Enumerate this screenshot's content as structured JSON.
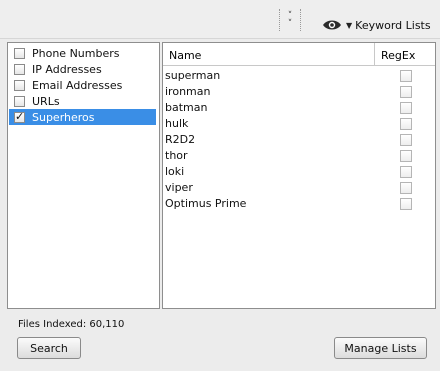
{
  "toolbar": {
    "overflow_icon": "double-chevron-down-icon",
    "keyword_lists_icon": "eye-icon",
    "keyword_lists_label": "Keyword Lists"
  },
  "lists": [
    {
      "label": "Phone Numbers",
      "checked": false,
      "selected": false
    },
    {
      "label": "IP Addresses",
      "checked": false,
      "selected": false
    },
    {
      "label": "Email Addresses",
      "checked": false,
      "selected": false
    },
    {
      "label": "URLs",
      "checked": false,
      "selected": false
    },
    {
      "label": "Superheros",
      "checked": true,
      "selected": true
    }
  ],
  "table": {
    "headers": {
      "name": "Name",
      "regex": "RegEx"
    },
    "rows": [
      {
        "name": "superman",
        "regex": false
      },
      {
        "name": "ironman",
        "regex": false
      },
      {
        "name": "batman",
        "regex": false
      },
      {
        "name": "hulk",
        "regex": false
      },
      {
        "name": "R2D2",
        "regex": false
      },
      {
        "name": "thor",
        "regex": false
      },
      {
        "name": "loki",
        "regex": false
      },
      {
        "name": "viper",
        "regex": false
      },
      {
        "name": "Optimus Prime",
        "regex": false
      }
    ]
  },
  "footer": {
    "files_indexed": "Files Indexed: 60,110",
    "search_label": "Search",
    "manage_label": "Manage Lists"
  },
  "colors": {
    "selection": "#3a8ee6",
    "background": "#ececec"
  }
}
